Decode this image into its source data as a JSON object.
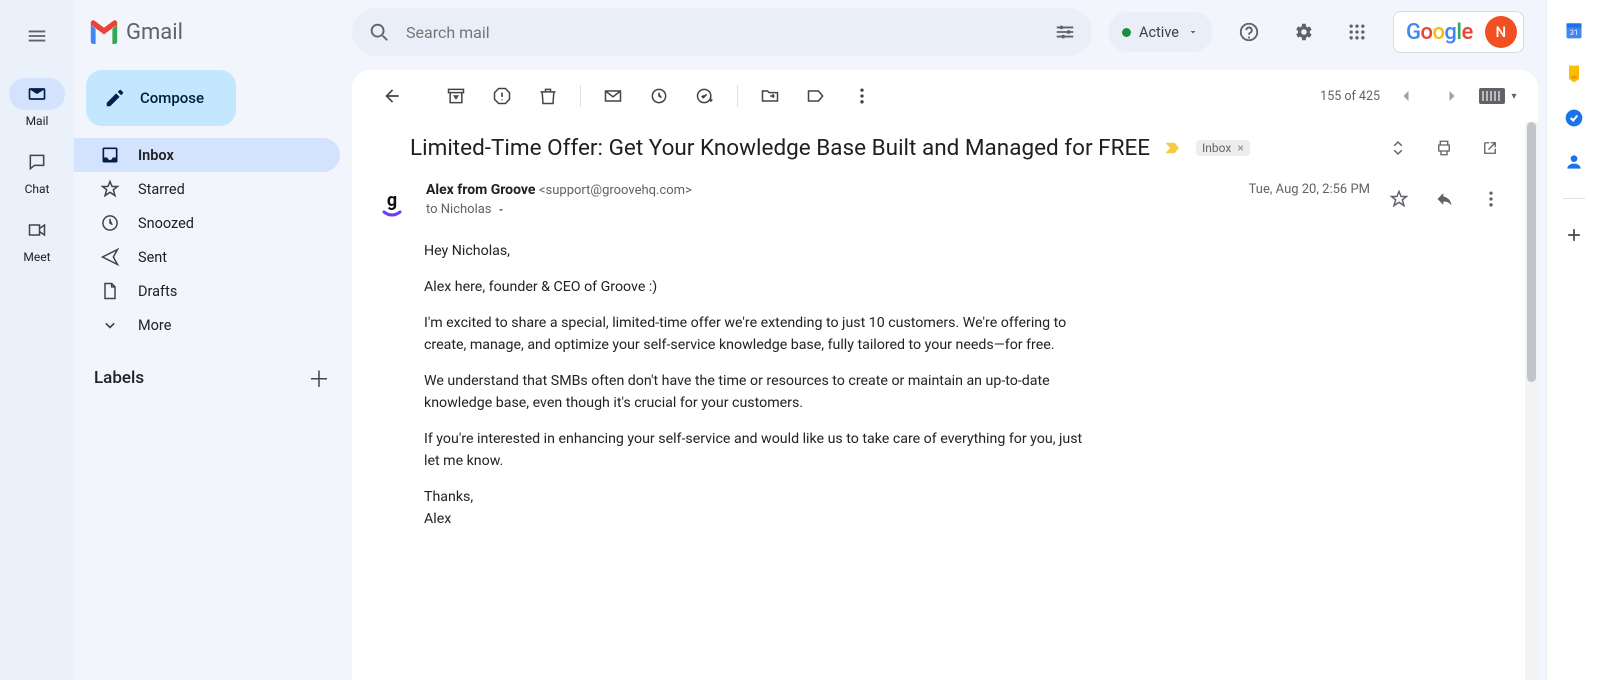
{
  "app_rail": {
    "items": [
      {
        "label": "Mail",
        "active": true
      },
      {
        "label": "Chat",
        "active": false
      },
      {
        "label": "Meet",
        "active": false
      }
    ]
  },
  "brand": "Gmail",
  "compose_label": "Compose",
  "search": {
    "placeholder": "Search mail"
  },
  "status": {
    "label": "Active"
  },
  "account": {
    "initial": "N"
  },
  "sidebar": {
    "items": [
      {
        "label": "Inbox",
        "active": true
      },
      {
        "label": "Starred"
      },
      {
        "label": "Snoozed"
      },
      {
        "label": "Sent"
      },
      {
        "label": "Drafts"
      },
      {
        "label": "More"
      }
    ],
    "labels_header": "Labels"
  },
  "toolbar": {
    "counter": "155 of 425"
  },
  "message": {
    "subject": "Limited-Time Offer: Get Your Knowledge Base Built and Managed for FREE",
    "label_chip": "Inbox",
    "sender_name": "Alex from Groove",
    "sender_email": "<support@groovehq.com>",
    "to_line": "to Nicholas",
    "date": "Tue, Aug 20, 2:56 PM",
    "body": {
      "p1": "Hey Nicholas,",
      "p2": "Alex here, founder & CEO of Groove :)",
      "p3": "I'm excited to share a special, limited-time offer we're extending to just 10 customers. We're offering to create, manage, and optimize your self-service knowledge base, fully tailored to your needs—for free.",
      "p4": "We understand that SMBs often don't have the time or resources to create or maintain an up-to-date knowledge base, even though it's crucial for your customers.",
      "p5": "If you're interested in enhancing your self-service and would like us to take care of everything for you, just let me know.",
      "p6": "Thanks,",
      "p7": "Alex"
    }
  },
  "google_word": "Google"
}
